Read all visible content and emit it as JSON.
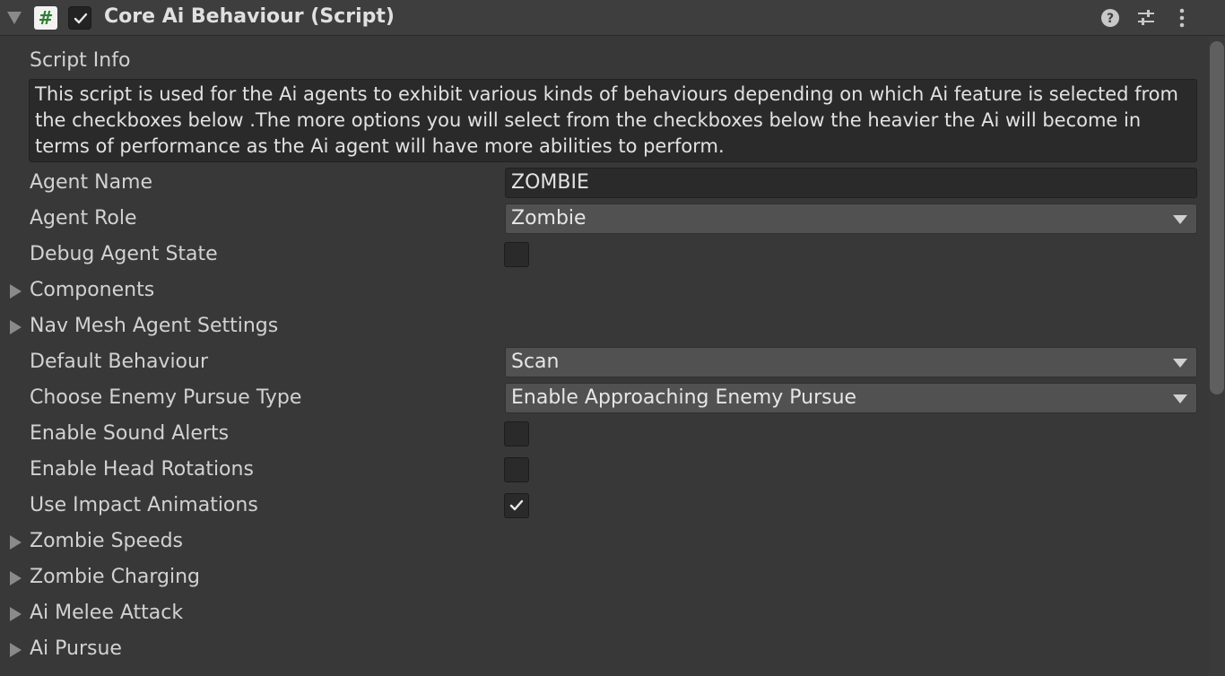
{
  "header": {
    "title": "Core Ai Behaviour (Script)",
    "script_icon": "#",
    "enabled": true,
    "icons": [
      "help-icon",
      "presets-icon",
      "menu-icon"
    ]
  },
  "script_info": {
    "label": "Script Info",
    "text": "This script is used for the Ai agents to exhibit various kinds of behaviours depending on which Ai feature is selected from the checkboxes below .The more options you will select from the checkboxes below the heavier the Ai will become in terms of performance as the Ai agent will have more abilities to perform."
  },
  "fields": {
    "agent_name": {
      "label": "Agent Name",
      "value": "ZOMBIE"
    },
    "agent_role": {
      "label": "Agent Role",
      "value": "Zombie"
    },
    "debug_agent_state": {
      "label": "Debug Agent State",
      "checked": false
    },
    "default_behaviour": {
      "label": "Default Behaviour",
      "value": "Scan"
    },
    "enemy_pursue_type": {
      "label": "Choose Enemy Pursue Type",
      "value": "Enable Approaching Enemy Pursue"
    },
    "enable_sound_alerts": {
      "label": "Enable Sound Alerts",
      "checked": false
    },
    "enable_head_rotations": {
      "label": "Enable Head Rotations",
      "checked": false
    },
    "use_impact_animations": {
      "label": "Use Impact Animations",
      "checked": true
    }
  },
  "foldouts": {
    "components": "Components",
    "nav_mesh_agent_settings": "Nav Mesh Agent Settings",
    "zombie_speeds": "Zombie Speeds",
    "zombie_charging": "Zombie Charging",
    "ai_melee_attack": "Ai Melee Attack",
    "ai_pursue": "Ai Pursue"
  },
  "colors": {
    "background": "#383838",
    "field": "#2a2a2a",
    "dropdown": "#515151",
    "text": "#d2d2d2"
  }
}
